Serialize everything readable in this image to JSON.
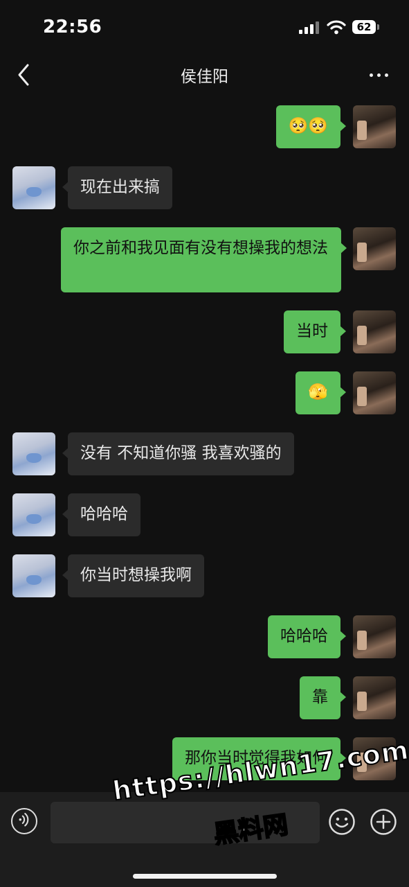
{
  "status_bar": {
    "time": "22:56",
    "battery": "62",
    "signal_icon": "cellular-signal-icon",
    "wifi_icon": "wifi-icon"
  },
  "header": {
    "title": "侯佳阳",
    "back_icon": "chevron-left-icon",
    "more_icon": "more-dots-icon"
  },
  "messages": [
    {
      "side": "me",
      "text": "🥺🥺"
    },
    {
      "side": "them",
      "text": "现在出来搞"
    },
    {
      "side": "me",
      "text": "你之前和我见面有没有想操我的想法"
    },
    {
      "side": "me",
      "text": "当时"
    },
    {
      "side": "me",
      "text": "🫣"
    },
    {
      "side": "them",
      "text": "没有 不知道你骚 我喜欢骚的"
    },
    {
      "side": "them",
      "text": "哈哈哈"
    },
    {
      "side": "them",
      "text": "你当时想操我啊"
    },
    {
      "side": "me",
      "text": "哈哈哈"
    },
    {
      "side": "me",
      "text": "靠"
    },
    {
      "side": "me",
      "text": "那你当时觉得我如何"
    }
  ],
  "input_bar": {
    "voice_icon": "voice-icon",
    "emoji_icon": "emoji-icon",
    "plus_icon": "plus-icon",
    "text_value": ""
  },
  "watermark": {
    "url": "https://hlwn17.com",
    "site": "黑料网"
  }
}
